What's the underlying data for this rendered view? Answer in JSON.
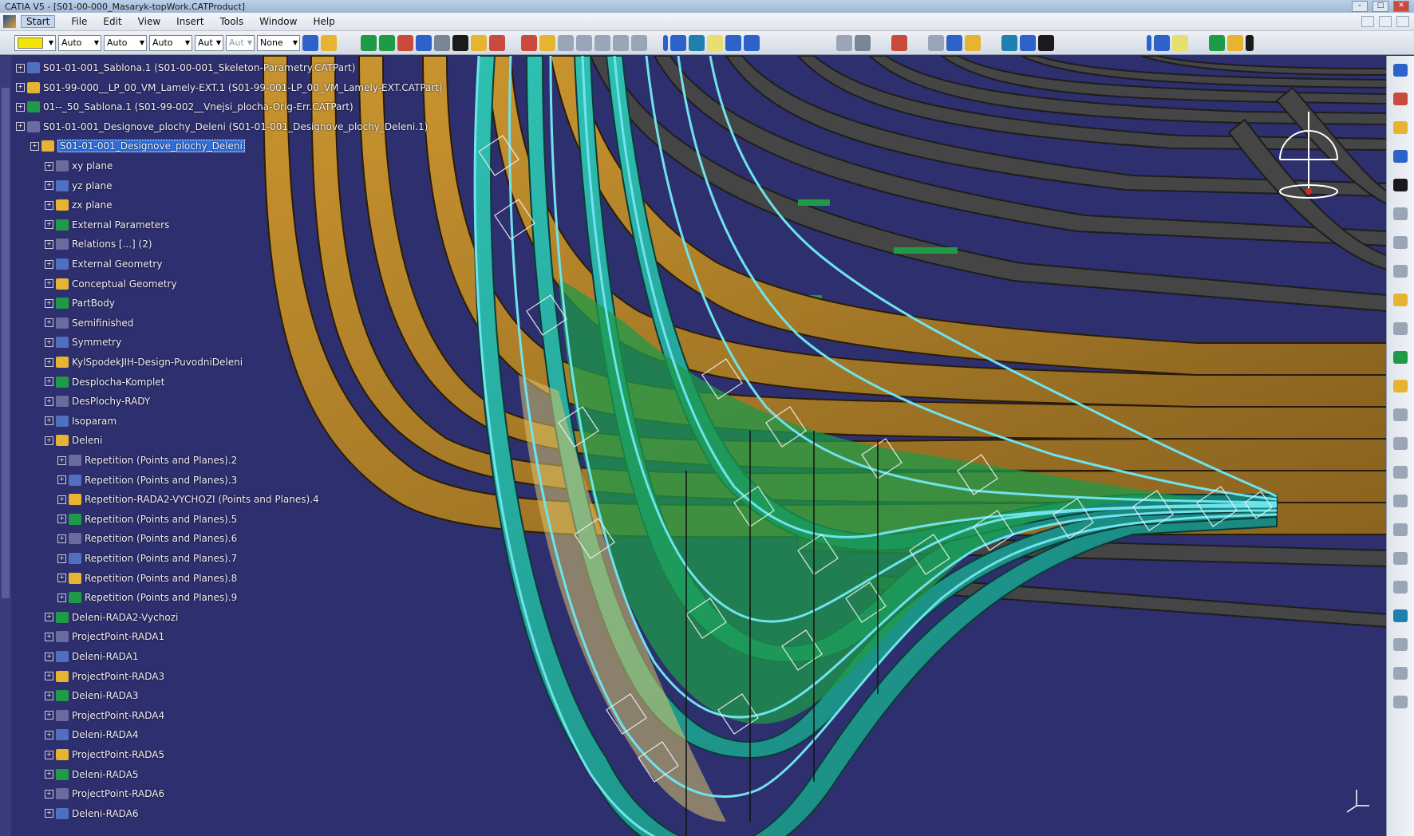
{
  "window": {
    "title": "CATIA V5 - [S01-00-000_Masaryk-topWork.CATProduct]"
  },
  "menu": {
    "items": [
      "Start",
      "File",
      "Edit",
      "View",
      "Insert",
      "Tools",
      "Window",
      "Help"
    ]
  },
  "toolbar": {
    "color_value": "",
    "line_type": "Auto",
    "thickness": "Auto",
    "linetype2": "Auto",
    "layer": "Aut",
    "layer2": "Aut",
    "render": "None"
  },
  "tree": {
    "rows": [
      {
        "label": "S01-01-001_Sablona.1 (S01-00-001_Skeleton-Parametry.CATPart)",
        "level": 0
      },
      {
        "label": "S01-99-000__LP_00_VM_Lamely-EXT.1 (S01-99-001-LP_00_VM_Lamely-EXT.CATPart)",
        "level": 0
      },
      {
        "label": "01--_50_Sablona.1 (S01-99-002__Vnejsi_plocha-Orig-Err.CATPart)",
        "level": 0
      },
      {
        "label": "S01-01-001_Designove_plochy_Deleni (S01-01-001_Designove_plochy_Deleni.1)",
        "level": 0
      },
      {
        "label": "S01-01-001_Designove_plochy_Deleni",
        "level": 1,
        "selected": true
      },
      {
        "label": "xy plane",
        "level": 2
      },
      {
        "label": "yz plane",
        "level": 2
      },
      {
        "label": "zx plane",
        "level": 2
      },
      {
        "label": "External Parameters",
        "level": 2
      },
      {
        "label": "Relations [...] (2)",
        "level": 2
      },
      {
        "label": "External Geometry",
        "level": 2
      },
      {
        "label": "Conceptual Geometry",
        "level": 2
      },
      {
        "label": "PartBody",
        "level": 2
      },
      {
        "label": "Semifinished",
        "level": 2
      },
      {
        "label": "Symmetry",
        "level": 2
      },
      {
        "label": "KylSpodekJIH-Design-PuvodniDeleni",
        "level": 2
      },
      {
        "label": "Desplocha-Komplet",
        "level": 2
      },
      {
        "label": "DesPlochy-RADY",
        "level": 2
      },
      {
        "label": "Isoparam",
        "level": 2
      },
      {
        "label": "Deleni",
        "level": 2
      },
      {
        "label": "Repetition (Points and Planes).2",
        "level": 3
      },
      {
        "label": "Repetition (Points and Planes).3",
        "level": 3
      },
      {
        "label": "Repetition-RADA2-VYCHOZI (Points and Planes).4",
        "level": 3
      },
      {
        "label": "Repetition (Points and Planes).5",
        "level": 3
      },
      {
        "label": "Repetition (Points and Planes).6",
        "level": 3
      },
      {
        "label": "Repetition (Points and Planes).7",
        "level": 3
      },
      {
        "label": "Repetition (Points and Planes).8",
        "level": 3
      },
      {
        "label": "Repetition (Points and Planes).9",
        "level": 3
      },
      {
        "label": "Deleni-RADA2-Vychozi",
        "level": 2
      },
      {
        "label": "ProjectPoint-RADA1",
        "level": 2
      },
      {
        "label": "Deleni-RADA1",
        "level": 2
      },
      {
        "label": "ProjectPoint-RADA3",
        "level": 2
      },
      {
        "label": "Deleni-RADA3",
        "level": 2
      },
      {
        "label": "ProjectPoint-RADA4",
        "level": 2
      },
      {
        "label": "Deleni-RADA4",
        "level": 2
      },
      {
        "label": "ProjectPoint-RADA5",
        "level": 2
      },
      {
        "label": "Deleni-RADA5",
        "level": 2
      },
      {
        "label": "ProjectPoint-RADA6",
        "level": 2
      },
      {
        "label": "Deleni-RADA6",
        "level": 2
      }
    ]
  },
  "colors": {
    "background": "#2e2f6e",
    "hull": "#b8862c",
    "surface": "#2aa89e",
    "curves": "#6fe3ee",
    "green": "#1f9a46",
    "dark": "#3c3c3c"
  },
  "compass_icon": "compass-icon",
  "axis_icon": "axis-triad-icon"
}
